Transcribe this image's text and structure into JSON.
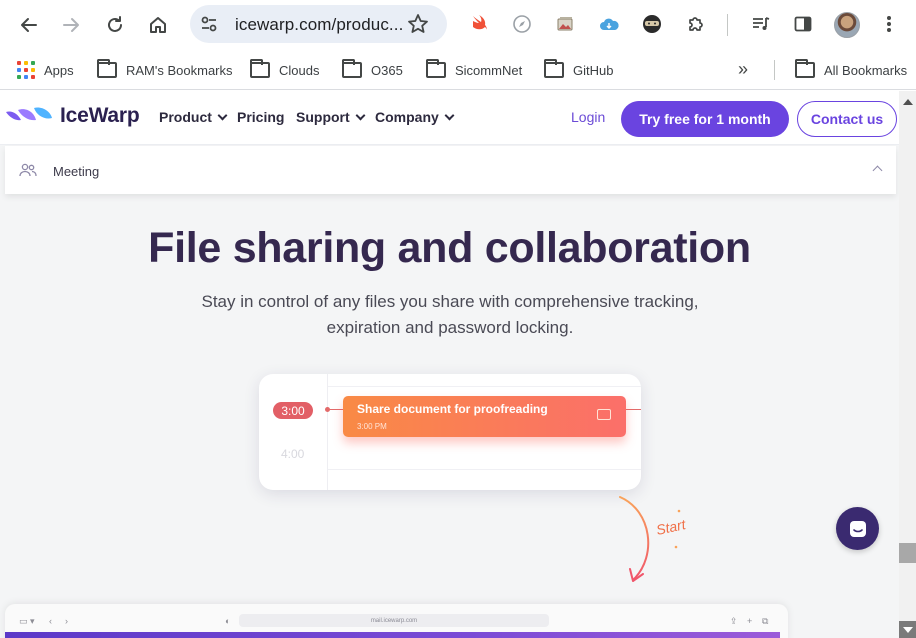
{
  "browser": {
    "url": "icewarp.com/produc...",
    "bookmarks": {
      "apps": "Apps",
      "folders": [
        "RAM's Bookmarks",
        "Clouds",
        "O365",
        "SicommNet",
        "GitHub"
      ],
      "all": "All Bookmarks"
    }
  },
  "site": {
    "brand": "IceWarp",
    "nav": [
      "Product",
      "Pricing",
      "Support",
      "Company"
    ],
    "login": "Login",
    "try_free": "Try free for 1 month",
    "contact": "Contact us",
    "submenu": {
      "label": "Meeting"
    }
  },
  "hero": {
    "title": "File sharing and collaboration",
    "subtitle_line1": "Stay in control of any files you share with comprehensive tracking,",
    "subtitle_line2": "expiration and password locking."
  },
  "calendar": {
    "current_time": "3:00",
    "next_time": "4:00",
    "event_title": "Share document for proofreading",
    "event_time": "3:00 PM",
    "start_label": "Start"
  },
  "mock_browser": {
    "url": "mail.icewarp.com"
  },
  "colors": {
    "accent": "#6a44e0",
    "heading": "#35284f",
    "event_orange": "#f98a45",
    "event_red": "#fb6f6a",
    "chat": "#3a2a70"
  }
}
